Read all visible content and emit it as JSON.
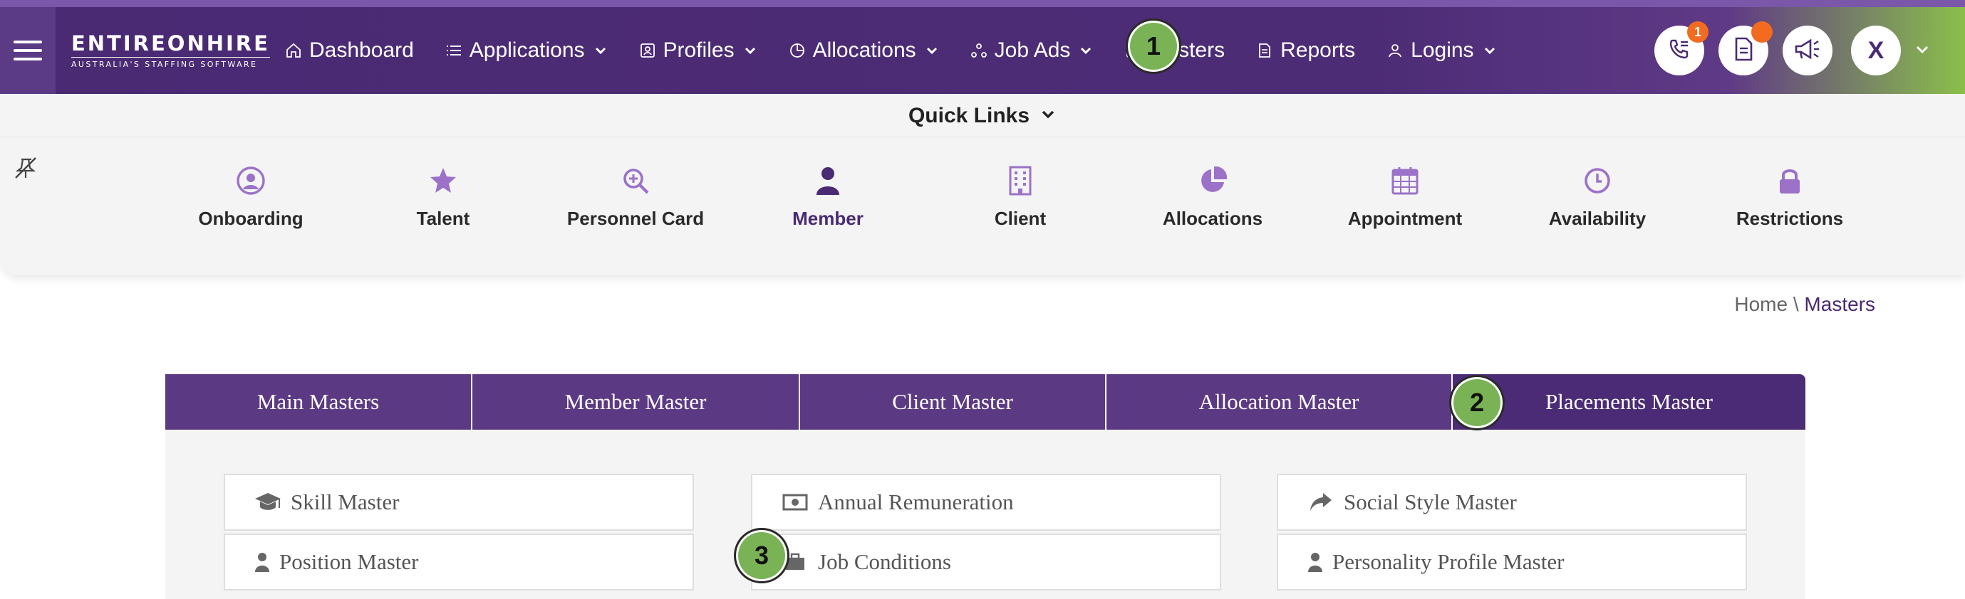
{
  "logo": {
    "main": "ENTIREONHIRE",
    "sub": "AUSTRALIA'S STAFFING SOFTWARE"
  },
  "nav": {
    "items": [
      {
        "label": "Dashboard",
        "icon": "home-icon",
        "dropdown": false
      },
      {
        "label": "Applications",
        "icon": "list-icon",
        "dropdown": true
      },
      {
        "label": "Profiles",
        "icon": "profile-card-icon",
        "dropdown": true
      },
      {
        "label": "Allocations",
        "icon": "pie-icon",
        "dropdown": true
      },
      {
        "label": "Job Ads",
        "icon": "network-icon",
        "dropdown": true
      },
      {
        "label": "Masters",
        "icon": "document-icon",
        "dropdown": false
      },
      {
        "label": "Reports",
        "icon": "report-icon",
        "dropdown": false
      },
      {
        "label": "Logins",
        "icon": "user-icon",
        "dropdown": true
      }
    ],
    "phone_badge": "1",
    "avatar_initial": "X"
  },
  "quick_links": {
    "title": "Quick Links",
    "items": [
      {
        "label": "Onboarding",
        "icon": "user-circle-icon"
      },
      {
        "label": "Talent",
        "icon": "star-icon"
      },
      {
        "label": "Personnel Card",
        "icon": "search-plus-icon"
      },
      {
        "label": "Member",
        "icon": "user-icon",
        "active": true
      },
      {
        "label": "Client",
        "icon": "building-icon"
      },
      {
        "label": "Allocations",
        "icon": "pie-chart-icon"
      },
      {
        "label": "Appointment",
        "icon": "calendar-icon"
      },
      {
        "label": "Availability",
        "icon": "clock-icon"
      },
      {
        "label": "Restrictions",
        "icon": "lock-icon"
      }
    ]
  },
  "breadcrumb": {
    "home": "Home",
    "separator": "\\",
    "current": "Masters"
  },
  "tabs": [
    {
      "label": "Main Masters"
    },
    {
      "label": "Member Master"
    },
    {
      "label": "Client Master"
    },
    {
      "label": "Allocation Master"
    },
    {
      "label": "Placements Master",
      "active": true
    }
  ],
  "cards": {
    "col1": [
      {
        "label": "Skill Master",
        "icon": "graduation-cap-icon"
      },
      {
        "label": "Position Master",
        "icon": "user-icon"
      }
    ],
    "col2": [
      {
        "label": "Annual Remuneration",
        "icon": "money-icon"
      },
      {
        "label": "Job Conditions",
        "icon": "briefcase-icon"
      }
    ],
    "col3": [
      {
        "label": "Social Style Master",
        "icon": "share-arrow-icon"
      },
      {
        "label": "Personality Profile Master",
        "icon": "user-icon"
      }
    ]
  },
  "markers": [
    "1",
    "2",
    "3"
  ],
  "colors": {
    "primary": "#4a2a73",
    "tab": "#5c3a83",
    "accent_green": "#7ab356",
    "icon_purple": "#9b72c8",
    "badge_orange": "#f26b21"
  }
}
